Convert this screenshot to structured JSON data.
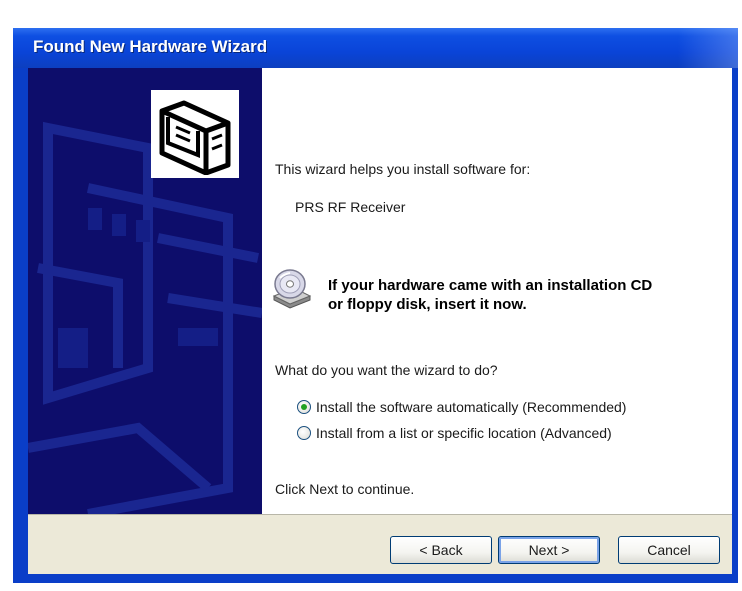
{
  "window": {
    "title": "Found New Hardware Wizard"
  },
  "content": {
    "intro": "This wizard helps you install software for:",
    "device_name": "PRS RF Receiver",
    "cd_message_line1": "If your hardware came with an installation CD",
    "cd_message_line2": "or floppy disk, insert it now.",
    "question": "What do you want the wizard to do?",
    "options": [
      {
        "label": "Install the software automatically (Recommended)",
        "selected": true
      },
      {
        "label": "Install from a list or specific location (Advanced)",
        "selected": false
      }
    ],
    "continue_hint": "Click Next to continue."
  },
  "buttons": {
    "back": "< Back",
    "next": "Next >",
    "cancel": "Cancel"
  },
  "icons": {
    "hardware": "hardware-card-icon",
    "cd": "cd-drive-icon"
  },
  "colors": {
    "titlebar": "#0a44d8",
    "side_panel": "#0d0d6b",
    "button_bar": "#ece9d8"
  }
}
